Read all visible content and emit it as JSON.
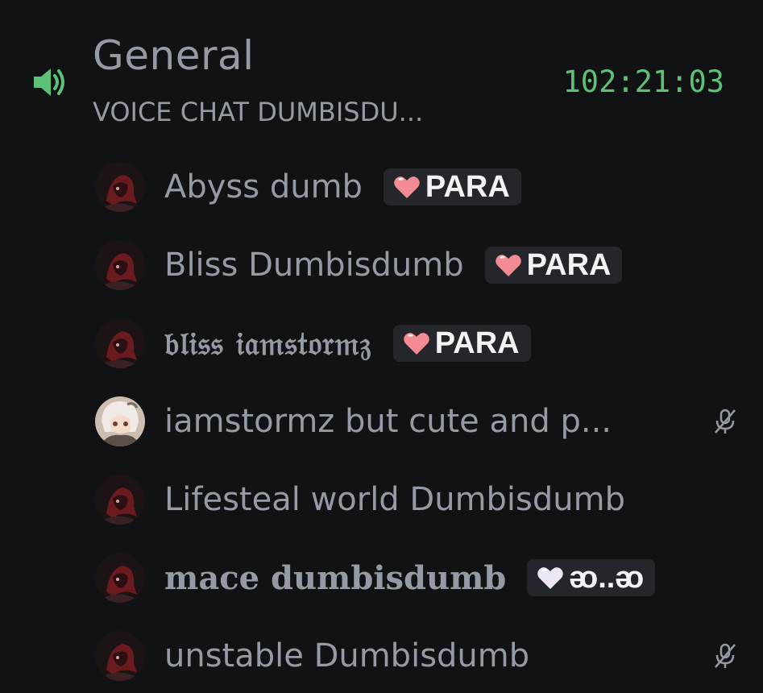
{
  "channel": {
    "name": "General",
    "status": "VOICE CHAT DUMBISDU...",
    "timer": "102:21:03",
    "icon": "speaker-icon",
    "accent_color": "#5dc177"
  },
  "members": [
    {
      "name": "Abyss dumb",
      "tag": "PARA",
      "tag_icon": "pink-heart-icon",
      "muted": false,
      "avatar": "dark-red-avatar"
    },
    {
      "name": "Bliss Dumbisdumb",
      "tag": "PARA",
      "tag_icon": "pink-heart-icon",
      "muted": false,
      "avatar": "dark-red-avatar"
    },
    {
      "name": "𝔟𝔩𝔦𝔰𝔰 𝔦𝔞𝔪𝔰𝔱𝔬𝔯𝔪𝔷",
      "tag": "PARA",
      "tag_icon": "pink-heart-icon",
      "muted": false,
      "avatar": "dark-red-avatar"
    },
    {
      "name": "iamstormz but cute and p...",
      "tag": "",
      "tag_icon": "",
      "muted": true,
      "avatar": "anime-avatar"
    },
    {
      "name": "Lifesteal world Dumbisdumb",
      "tag": "",
      "tag_icon": "",
      "muted": false,
      "avatar": "dark-red-avatar"
    },
    {
      "name": "mace dumbisdumb",
      "tag": "ᴔ..ᴔ",
      "tag_icon": "white-heart-icon",
      "muted": false,
      "avatar": "dark-red-avatar"
    },
    {
      "name": "unstable Dumbisdumb",
      "tag": "",
      "tag_icon": "",
      "muted": true,
      "avatar": "dark-red-avatar"
    }
  ],
  "colors": {
    "background": "#111214",
    "text_muted": "#949ba4",
    "tag_bg": "#24262b",
    "tag_text": "#f2f3f5",
    "heart_pink": "#f28b93",
    "heart_white": "#ece6f5"
  }
}
